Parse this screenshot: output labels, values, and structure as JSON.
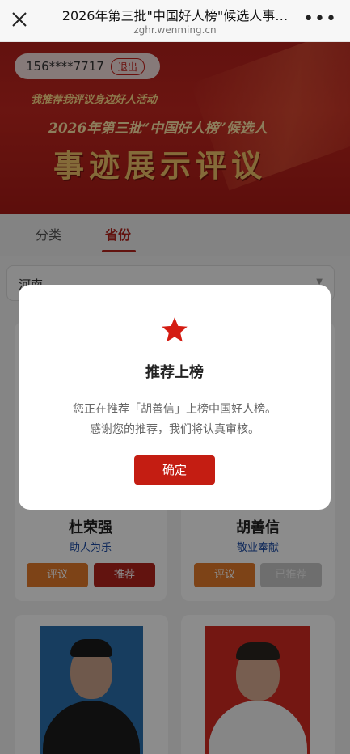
{
  "browser": {
    "title": "2026年第三批\"中国好人榜\"候选人事…",
    "url": "zghr.wenming.cn",
    "more_label": "•••"
  },
  "banner": {
    "phone": "156****7717",
    "logout_label": "退出",
    "line1": "我推荐我评议身边好人活动",
    "line2": "2026年第三批“中国好人榜”候选人",
    "line3": "事迹展示评议"
  },
  "tabs": [
    {
      "label": "分类"
    },
    {
      "label": "省份"
    }
  ],
  "province_select": {
    "value": "河南",
    "arrow": "▼"
  },
  "candidates": [
    {
      "name": "杜荣强",
      "tag": "助人为乐",
      "comment_label": "评议",
      "recommend_label": "推荐"
    },
    {
      "name": "胡善信",
      "tag": "敬业奉献",
      "comment_label": "评议",
      "recommend_label": "已推荐"
    }
  ],
  "modal": {
    "title": "推荐上榜",
    "message_line1": "您正在推荐「胡善信」上榜中国好人榜。",
    "message_line2": "感谢您的推荐，我们将认真审核。",
    "confirm_label": "确定"
  },
  "colors": {
    "accent_red": "#b3231c",
    "confirm_red": "#c41d12",
    "comment_orange": "#e37a2b",
    "tag_blue": "#1f4ea6"
  }
}
